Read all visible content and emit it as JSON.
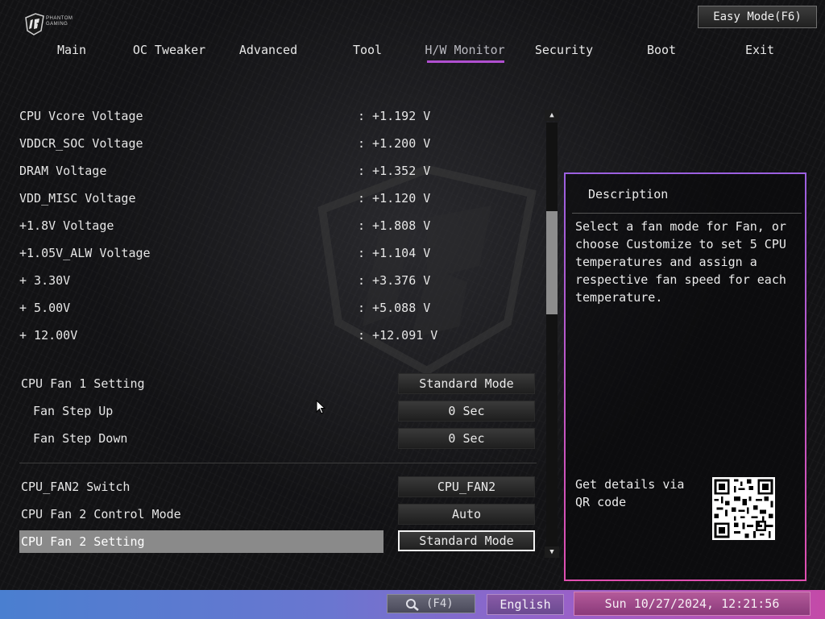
{
  "brand": {
    "logo_text_line1": "PHANTOM",
    "logo_text_line2": "GAMING"
  },
  "header": {
    "easy_mode_label": "Easy Mode(F6)"
  },
  "nav": {
    "tabs": [
      {
        "label": "Main"
      },
      {
        "label": "OC Tweaker"
      },
      {
        "label": "Advanced"
      },
      {
        "label": "Tool"
      },
      {
        "label": "H/W Monitor"
      },
      {
        "label": "Security"
      },
      {
        "label": "Boot"
      },
      {
        "label": "Exit"
      }
    ],
    "active": "H/W Monitor"
  },
  "voltages": [
    {
      "label": "CPU Vcore Voltage",
      "value": ": +1.192 V"
    },
    {
      "label": "VDDCR_SOC Voltage",
      "value": ": +1.200 V"
    },
    {
      "label": "DRAM Voltage",
      "value": ": +1.352 V"
    },
    {
      "label": "VDD_MISC Voltage",
      "value": ": +1.120 V"
    },
    {
      "label": "+1.8V Voltage",
      "value": ": +1.808 V"
    },
    {
      "label": "+1.05V_ALW Voltage",
      "value": ": +1.104 V"
    },
    {
      "label": "+ 3.30V",
      "value": ": +3.376 V"
    },
    {
      "label": "+ 5.00V",
      "value": ": +5.088 V"
    },
    {
      "label": "+ 12.00V",
      "value": ": +12.091 V"
    }
  ],
  "settings_group1": [
    {
      "label": "CPU Fan 1 Setting",
      "value": "Standard Mode"
    },
    {
      "label": "Fan Step Up",
      "value": "0 Sec"
    },
    {
      "label": "Fan Step Down",
      "value": "0 Sec"
    }
  ],
  "settings_group2": [
    {
      "label": "CPU_FAN2 Switch",
      "value": "CPU_FAN2"
    },
    {
      "label": "CPU Fan 2 Control Mode",
      "value": "Auto"
    },
    {
      "label": "CPU Fan 2 Setting",
      "value": "Standard Mode",
      "selected": true
    }
  ],
  "scrollbar": {
    "up_arrow": "▲",
    "down_arrow": "▼"
  },
  "description": {
    "title": "Description",
    "text": "Select a fan mode for Fan, or choose Customize to set 5 CPU temperatures and assign a respective fan speed for each temperature.",
    "qr_text": "Get details via QR code"
  },
  "statusbar": {
    "search_key": "(F4)",
    "language": "English",
    "datetime": "Sun 10/27/2024, 12:21:56"
  },
  "colors": {
    "accent": "#b04fd0",
    "selection": "#8a8a8a"
  }
}
